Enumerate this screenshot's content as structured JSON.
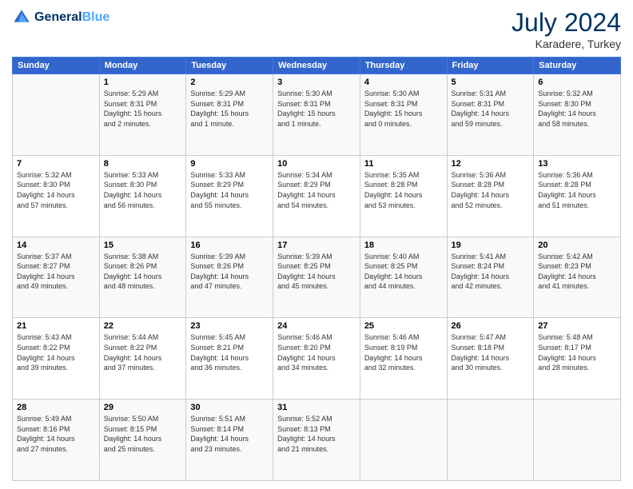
{
  "header": {
    "logo_general": "General",
    "logo_blue": "Blue",
    "month_year": "July 2024",
    "location": "Karadere, Turkey"
  },
  "calendar": {
    "days_of_week": [
      "Sunday",
      "Monday",
      "Tuesday",
      "Wednesday",
      "Thursday",
      "Friday",
      "Saturday"
    ],
    "weeks": [
      [
        {
          "day": "",
          "info": ""
        },
        {
          "day": "1",
          "info": "Sunrise: 5:29 AM\nSunset: 8:31 PM\nDaylight: 15 hours\nand 2 minutes."
        },
        {
          "day": "2",
          "info": "Sunrise: 5:29 AM\nSunset: 8:31 PM\nDaylight: 15 hours\nand 1 minute."
        },
        {
          "day": "3",
          "info": "Sunrise: 5:30 AM\nSunset: 8:31 PM\nDaylight: 15 hours\nand 1 minute."
        },
        {
          "day": "4",
          "info": "Sunrise: 5:30 AM\nSunset: 8:31 PM\nDaylight: 15 hours\nand 0 minutes."
        },
        {
          "day": "5",
          "info": "Sunrise: 5:31 AM\nSunset: 8:31 PM\nDaylight: 14 hours\nand 59 minutes."
        },
        {
          "day": "6",
          "info": "Sunrise: 5:32 AM\nSunset: 8:30 PM\nDaylight: 14 hours\nand 58 minutes."
        }
      ],
      [
        {
          "day": "7",
          "info": "Sunrise: 5:32 AM\nSunset: 8:30 PM\nDaylight: 14 hours\nand 57 minutes."
        },
        {
          "day": "8",
          "info": "Sunrise: 5:33 AM\nSunset: 8:30 PM\nDaylight: 14 hours\nand 56 minutes."
        },
        {
          "day": "9",
          "info": "Sunrise: 5:33 AM\nSunset: 8:29 PM\nDaylight: 14 hours\nand 55 minutes."
        },
        {
          "day": "10",
          "info": "Sunrise: 5:34 AM\nSunset: 8:29 PM\nDaylight: 14 hours\nand 54 minutes."
        },
        {
          "day": "11",
          "info": "Sunrise: 5:35 AM\nSunset: 8:28 PM\nDaylight: 14 hours\nand 53 minutes."
        },
        {
          "day": "12",
          "info": "Sunrise: 5:36 AM\nSunset: 8:28 PM\nDaylight: 14 hours\nand 52 minutes."
        },
        {
          "day": "13",
          "info": "Sunrise: 5:36 AM\nSunset: 8:28 PM\nDaylight: 14 hours\nand 51 minutes."
        }
      ],
      [
        {
          "day": "14",
          "info": "Sunrise: 5:37 AM\nSunset: 8:27 PM\nDaylight: 14 hours\nand 49 minutes."
        },
        {
          "day": "15",
          "info": "Sunrise: 5:38 AM\nSunset: 8:26 PM\nDaylight: 14 hours\nand 48 minutes."
        },
        {
          "day": "16",
          "info": "Sunrise: 5:39 AM\nSunset: 8:26 PM\nDaylight: 14 hours\nand 47 minutes."
        },
        {
          "day": "17",
          "info": "Sunrise: 5:39 AM\nSunset: 8:25 PM\nDaylight: 14 hours\nand 45 minutes."
        },
        {
          "day": "18",
          "info": "Sunrise: 5:40 AM\nSunset: 8:25 PM\nDaylight: 14 hours\nand 44 minutes."
        },
        {
          "day": "19",
          "info": "Sunrise: 5:41 AM\nSunset: 8:24 PM\nDaylight: 14 hours\nand 42 minutes."
        },
        {
          "day": "20",
          "info": "Sunrise: 5:42 AM\nSunset: 8:23 PM\nDaylight: 14 hours\nand 41 minutes."
        }
      ],
      [
        {
          "day": "21",
          "info": "Sunrise: 5:43 AM\nSunset: 8:22 PM\nDaylight: 14 hours\nand 39 minutes."
        },
        {
          "day": "22",
          "info": "Sunrise: 5:44 AM\nSunset: 8:22 PM\nDaylight: 14 hours\nand 37 minutes."
        },
        {
          "day": "23",
          "info": "Sunrise: 5:45 AM\nSunset: 8:21 PM\nDaylight: 14 hours\nand 36 minutes."
        },
        {
          "day": "24",
          "info": "Sunrise: 5:46 AM\nSunset: 8:20 PM\nDaylight: 14 hours\nand 34 minutes."
        },
        {
          "day": "25",
          "info": "Sunrise: 5:46 AM\nSunset: 8:19 PM\nDaylight: 14 hours\nand 32 minutes."
        },
        {
          "day": "26",
          "info": "Sunrise: 5:47 AM\nSunset: 8:18 PM\nDaylight: 14 hours\nand 30 minutes."
        },
        {
          "day": "27",
          "info": "Sunrise: 5:48 AM\nSunset: 8:17 PM\nDaylight: 14 hours\nand 28 minutes."
        }
      ],
      [
        {
          "day": "28",
          "info": "Sunrise: 5:49 AM\nSunset: 8:16 PM\nDaylight: 14 hours\nand 27 minutes."
        },
        {
          "day": "29",
          "info": "Sunrise: 5:50 AM\nSunset: 8:15 PM\nDaylight: 14 hours\nand 25 minutes."
        },
        {
          "day": "30",
          "info": "Sunrise: 5:51 AM\nSunset: 8:14 PM\nDaylight: 14 hours\nand 23 minutes."
        },
        {
          "day": "31",
          "info": "Sunrise: 5:52 AM\nSunset: 8:13 PM\nDaylight: 14 hours\nand 21 minutes."
        },
        {
          "day": "",
          "info": ""
        },
        {
          "day": "",
          "info": ""
        },
        {
          "day": "",
          "info": ""
        }
      ]
    ]
  }
}
